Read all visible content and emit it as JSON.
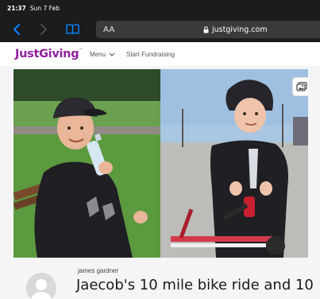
{
  "status_bar": {
    "time": "21:37",
    "date": "Sun 7 Feb"
  },
  "browser": {
    "text_size_label": "AA",
    "url": "justgiving.com",
    "icons": {
      "back": "chevron-left-icon",
      "forward": "chevron-right-icon",
      "bookmarks": "book-icon",
      "lock": "lock-icon"
    }
  },
  "site_header": {
    "logo": "JustGiving",
    "menu_label": "Menu",
    "start_fundraising_label": "Start Fundraising"
  },
  "fundraiser": {
    "owner_name": "james gardner",
    "title": "Jaecob's 10 mile bike ride and 10"
  },
  "colors": {
    "brand": "#8f1e9c",
    "chrome": "#1c1c1e",
    "link_blue": "#0a84ff"
  }
}
